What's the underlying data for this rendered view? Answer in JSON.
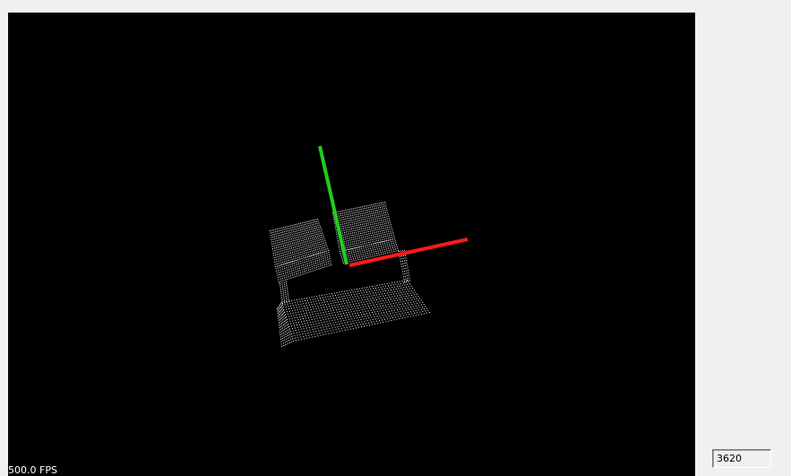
{
  "viewer": {
    "background_color": "#000000",
    "point_color": "#ffffff",
    "fps_label": "500.0 FPS",
    "axes": {
      "x_color": "#ff1a1a",
      "y_color": "#1fcf1f"
    }
  },
  "side_panel": {
    "point_count_value": "3620"
  }
}
